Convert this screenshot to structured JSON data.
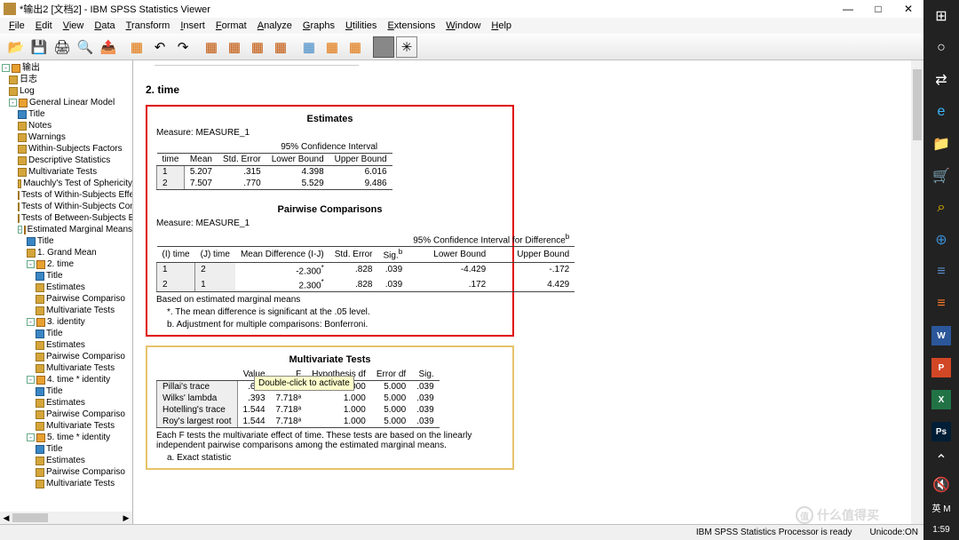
{
  "window": {
    "title": "*输出2 [文档2] - IBM SPSS Statistics Viewer",
    "min": "—",
    "max": "□",
    "close": "✕"
  },
  "menus": [
    "File",
    "Edit",
    "View",
    "Data",
    "Transform",
    "Insert",
    "Format",
    "Analyze",
    "Graphs",
    "Utilities",
    "Extensions",
    "Window",
    "Help"
  ],
  "outline": {
    "root": "输出",
    "items": [
      {
        "i": 0,
        "t": "日志",
        "ic": "cb"
      },
      {
        "i": 0,
        "t": "Log",
        "ic": "cb"
      },
      {
        "i": 0,
        "t": "General Linear Model",
        "ic": "cg",
        "tgl": "-"
      },
      {
        "i": 1,
        "t": "Title",
        "ic": "ct"
      },
      {
        "i": 1,
        "t": "Notes",
        "ic": "cb"
      },
      {
        "i": 1,
        "t": "Warnings",
        "ic": "cb"
      },
      {
        "i": 1,
        "t": "Within-Subjects Factors",
        "ic": "cb"
      },
      {
        "i": 1,
        "t": "Descriptive Statistics",
        "ic": "cb"
      },
      {
        "i": 1,
        "t": "Multivariate Tests",
        "ic": "cb"
      },
      {
        "i": 1,
        "t": "Mauchly's Test of Sphericity",
        "ic": "cb"
      },
      {
        "i": 1,
        "t": "Tests of Within-Subjects Effe",
        "ic": "cb"
      },
      {
        "i": 1,
        "t": "Tests of Within-Subjects Con",
        "ic": "cb"
      },
      {
        "i": 1,
        "t": "Tests of Between-Subjects E",
        "ic": "cb"
      },
      {
        "i": 1,
        "t": "Estimated Marginal Means",
        "ic": "cg",
        "tgl": "-"
      },
      {
        "i": 2,
        "t": "Title",
        "ic": "ct"
      },
      {
        "i": 2,
        "t": "1. Grand Mean",
        "ic": "cb"
      },
      {
        "i": 2,
        "t": "2. time",
        "ic": "cg",
        "tgl": "-"
      },
      {
        "i": 3,
        "t": "Title",
        "ic": "ct"
      },
      {
        "i": 3,
        "t": "Estimates",
        "ic": "cb"
      },
      {
        "i": 3,
        "t": "Pairwise Compariso",
        "ic": "cb"
      },
      {
        "i": 3,
        "t": "Multivariate Tests",
        "ic": "cb"
      },
      {
        "i": 2,
        "t": "3. identity",
        "ic": "cg",
        "tgl": "-"
      },
      {
        "i": 3,
        "t": "Title",
        "ic": "ct"
      },
      {
        "i": 3,
        "t": "Estimates",
        "ic": "cb"
      },
      {
        "i": 3,
        "t": "Pairwise Compariso",
        "ic": "cb"
      },
      {
        "i": 3,
        "t": "Multivariate Tests",
        "ic": "cb"
      },
      {
        "i": 2,
        "t": "4. time * identity",
        "ic": "cg",
        "tgl": "-"
      },
      {
        "i": 3,
        "t": "Title",
        "ic": "ct"
      },
      {
        "i": 3,
        "t": "Estimates",
        "ic": "cb"
      },
      {
        "i": 3,
        "t": "Pairwise Compariso",
        "ic": "cb"
      },
      {
        "i": 3,
        "t": "Multivariate Tests",
        "ic": "cb"
      },
      {
        "i": 2,
        "t": "5. time * identity",
        "ic": "cg",
        "tgl": "-"
      },
      {
        "i": 3,
        "t": "Title",
        "ic": "ct"
      },
      {
        "i": 3,
        "t": "Estimates",
        "ic": "cb"
      },
      {
        "i": 3,
        "t": "Pairwise Compariso",
        "ic": "cb"
      },
      {
        "i": 3,
        "t": "Multivariate Tests",
        "ic": "cb"
      }
    ]
  },
  "section_title": "2. time",
  "estimates": {
    "title": "Estimates",
    "measure": "Measure:   MEASURE_1",
    "ci_label": "95% Confidence Interval",
    "cols": [
      "time",
      "Mean",
      "Std. Error",
      "Lower Bound",
      "Upper Bound"
    ],
    "rows": [
      [
        "1",
        "5.207",
        ".315",
        "4.398",
        "6.016"
      ],
      [
        "2",
        "7.507",
        ".770",
        "5.529",
        "9.486"
      ]
    ]
  },
  "pairwise": {
    "title": "Pairwise Comparisons",
    "measure": "Measure:   MEASURE_1",
    "ci_label": "95% Confidence Interval for Difference",
    "cols": [
      "(I) time",
      "(J) time",
      "Mean Difference (I-J)",
      "Std. Error",
      "Sig.",
      "Lower Bound",
      "Upper Bound"
    ],
    "rows": [
      [
        "1",
        "2",
        "-2.300*",
        ".828",
        ".039",
        "-4.429",
        "-.172"
      ],
      [
        "2",
        "1",
        "2.300*",
        ".828",
        ".039",
        ".172",
        "4.429"
      ]
    ],
    "foot1": "Based on estimated marginal means",
    "foot2": "*. The mean difference is significant at the .05 level.",
    "foot3": "b. Adjustment for multiple comparisons: Bonferroni."
  },
  "multivariate": {
    "title": "Multivariate Tests",
    "cols": [
      "",
      "Value",
      "F",
      "Hypothesis df",
      "Error df",
      "Sig."
    ],
    "rows": [
      [
        "Pillai's trace",
        ".607",
        "7.718ᵃ",
        "1.000",
        "5.000",
        ".039"
      ],
      [
        "Wilks' lambda",
        ".393",
        "7.718ᵃ",
        "1.000",
        "5.000",
        ".039"
      ],
      [
        "Hotelling's trace",
        "1.544",
        "7.718ᵃ",
        "1.000",
        "5.000",
        ".039"
      ],
      [
        "Roy's largest root",
        "1.544",
        "7.718ᵃ",
        "1.000",
        "5.000",
        ".039"
      ]
    ],
    "foot1": "Each F tests the multivariate effect of time. These tests are based on the linearly independent pairwise comparisons among the estimated marginal means.",
    "foot2": "a. Exact statistic"
  },
  "tooltip": "Double-click to activate",
  "status": {
    "left": "",
    "ready": "IBM SPSS Statistics Processor is ready",
    "unicode": "Unicode:ON"
  },
  "watermark": "什么值得买",
  "sidebar_icons": [
    "⊞",
    "○",
    "⇄",
    "e",
    "📁",
    "🛒",
    "⌕",
    "⊕",
    "≡",
    "≡",
    "W",
    "P",
    "X",
    "Ps"
  ],
  "sidebar_bottom": {
    "wifi": "⌃",
    "spk": "🔇",
    "lang": "英 M",
    "time": "1:59"
  }
}
